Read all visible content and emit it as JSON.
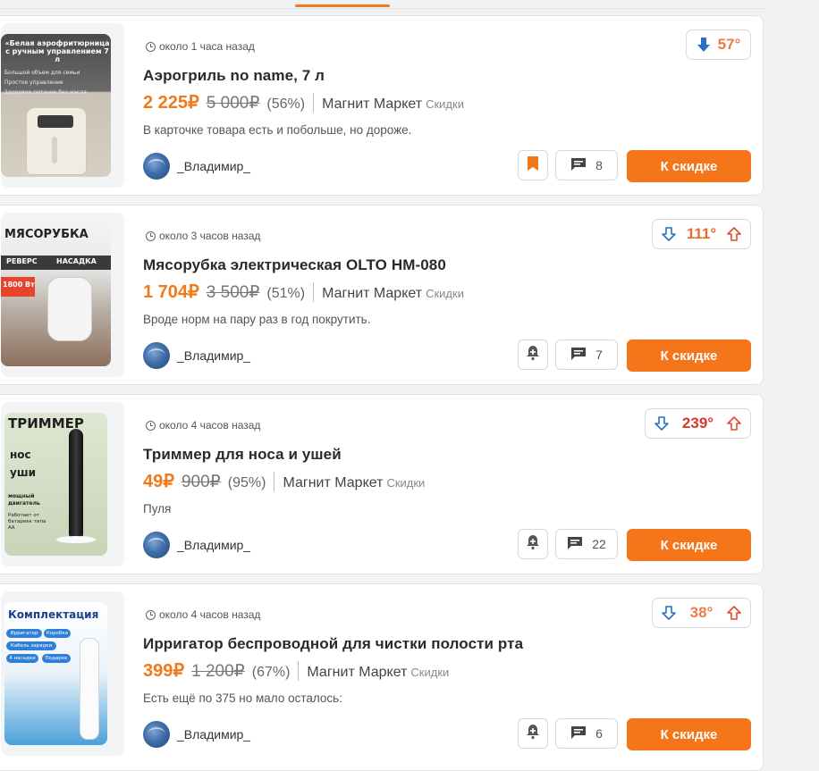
{
  "colors": {
    "accent": "#f5761a",
    "hot": "#e4492c",
    "warm": "#f07a4a",
    "blue_arrow": "#2a6fc6"
  },
  "deals": [
    {
      "thumb_text": "«Белая аэрофритюрница с ручным управлением 7 л",
      "thumb_bullets": [
        "Большой объем для семьи",
        "Простое управление",
        "Здоровое питание без масла"
      ],
      "time": "около 1 часа назад",
      "title": "Аэрогриль no name, 7 л",
      "price": "2 225₽",
      "old_price": "5 000₽",
      "discount": "(56%)",
      "store": "Магнит Маркет",
      "category": "Скидки",
      "description": "В карточке товара есть и побольше, но дороже.",
      "author": "_Владимир_",
      "comments": "8",
      "button": "К скидке",
      "temperature": "57°",
      "square_icon": "bookmark-icon"
    },
    {
      "thumb_text": "МЯСОРУБКА",
      "thumb_sub": [
        "РЕВЕРС",
        "НАСАДКА",
        "1800 Вт"
      ],
      "time": "около 3 часов назад",
      "title": "Мясорубка электрическая OLTO HM-080",
      "price": "1 704₽",
      "old_price": "3 500₽",
      "discount": "(51%)",
      "store": "Магнит Маркет",
      "category": "Скидки",
      "description": "Вроде норм на пару раз в год покрутить.",
      "author": "_Владимир_",
      "comments": "7",
      "button": "К скидке",
      "temperature": "111°",
      "square_icon": "bell-plus-icon"
    },
    {
      "thumb_text": "ТРИММЕР",
      "thumb_sub": [
        "нос",
        "уши",
        "мощный двигатель",
        "Работает от батареек типа АА"
      ],
      "time": "около 4 часов назад",
      "title": "Триммер для носа и ушей",
      "price": "49₽",
      "old_price": "900₽",
      "discount": "(95%)",
      "store": "Магнит Маркет",
      "category": "Скидки",
      "description": "Пуля",
      "author": "_Владимир_",
      "comments": "22",
      "button": "К скидке",
      "temperature": "239°",
      "square_icon": "bell-plus-icon"
    },
    {
      "thumb_text": "Комплектация",
      "thumb_sub": [
        "Ирригатор",
        "Коробка",
        "Кабель зарядки",
        "4 насадки",
        "Подарок"
      ],
      "time": "около 4 часов назад",
      "title": "Ирригатор беспроводной для чистки полости рта",
      "price": "399₽",
      "old_price": "1 200₽",
      "discount": "(67%)",
      "store": "Магнит Маркет",
      "category": "Скидки",
      "description": "Есть ещё по 375 но мало осталось:",
      "author": "_Владимир_",
      "comments": "6",
      "button": "К скидке",
      "temperature": "38°",
      "square_icon": "bell-plus-icon"
    }
  ]
}
